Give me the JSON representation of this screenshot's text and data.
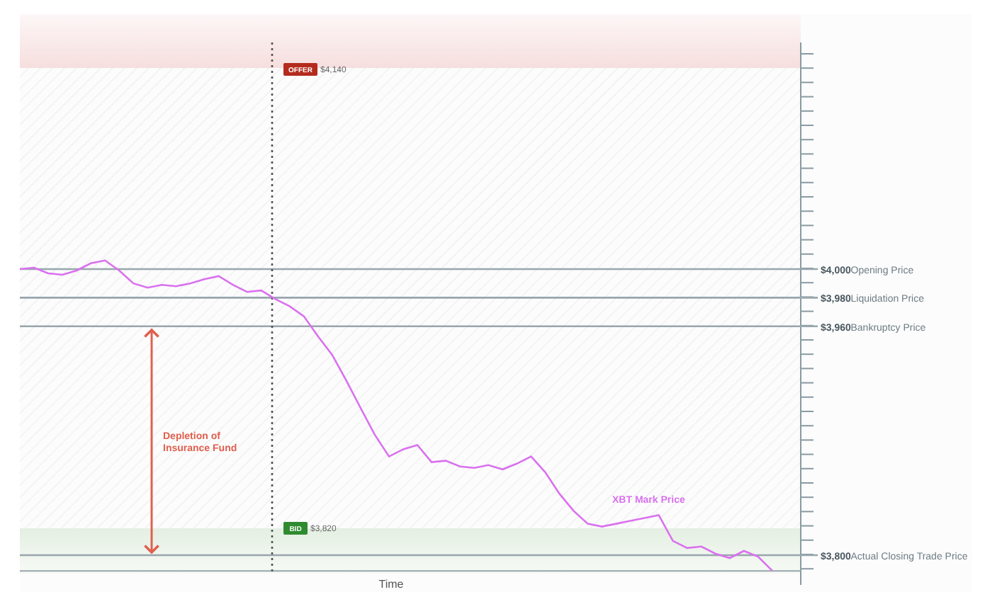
{
  "price_level_names": [
    "Opening Price",
    "Liquidation Price",
    "Bankruptcy Price",
    "Actual Closing Trade Price"
  ],
  "offer": {
    "badge": "OFFER",
    "price": "$4,140"
  },
  "bid": {
    "badge": "BID",
    "price": "$3,820"
  },
  "annotation": [
    "Depletion of",
    "Insurance Fund"
  ],
  "chart_data": {
    "type": "line",
    "xlabel": "Time",
    "ylim": [
      3779.2,
      4158.4
    ],
    "grid": true,
    "ref_lines": [
      {
        "axis": "y",
        "value": 3789
      }
    ],
    "yticks": [
      {
        "value": 4000,
        "label": "$4,000"
      },
      {
        "value": 3980,
        "label": "$3,980"
      },
      {
        "value": 3960,
        "label": "$3,960"
      },
      {
        "value": 3800,
        "label": "$3,800"
      }
    ],
    "series": [
      {
        "name": "XBT Mark Price",
        "color": "#d971ee",
        "values": [
          4000,
          4001,
          3997,
          3996,
          3999,
          4004,
          4006,
          3999,
          3990,
          3987,
          3989,
          3988,
          3990,
          3993,
          3995,
          3989,
          3984,
          3985,
          3979,
          3974,
          3967,
          3953,
          3940,
          3922,
          3903,
          3884,
          3869,
          3874,
          3877,
          3865,
          3866,
          3862,
          3861,
          3863,
          3860,
          3864,
          3869,
          3858,
          3843,
          3831,
          3822,
          3820,
          3822,
          3824,
          3826,
          3828,
          3810,
          3805,
          3806,
          3801,
          3798,
          3803,
          3799,
          3789
        ]
      }
    ]
  }
}
